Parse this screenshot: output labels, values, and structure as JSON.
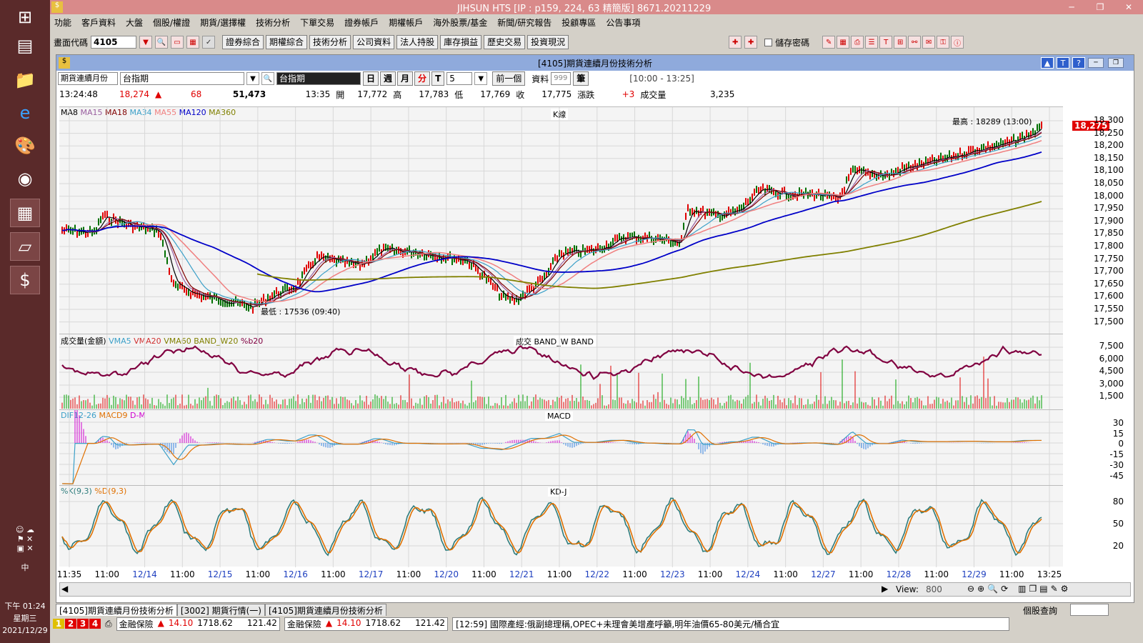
{
  "window": {
    "title": "JIHSUN HTS    [IP : p159, 224, 63 精簡版] 8671.20211229"
  },
  "menu": [
    "功能",
    "客戶資料",
    "大盤",
    "個股/權證",
    "期貨/選擇權",
    "技術分析",
    "下單交易",
    "證券帳戶",
    "期權帳戶",
    "海外股票/基金",
    "新聞/研究報告",
    "投顧專區",
    "公告事項"
  ],
  "toolbar": {
    "code_label": "畫面代碼",
    "code_value": "4105",
    "buttons": [
      "證券綜合",
      "期權綜合",
      "技術分析",
      "公司資料",
      "法人持股",
      "庫存損益",
      "歷史交易",
      "投資現況"
    ],
    "save_password": "儲存密碼"
  },
  "inner": {
    "title": "[4105]期貨連續月份技術分析",
    "symbol_type": "期貨連續月份",
    "symbol_name": "台指期",
    "symbol_selected": "台指期",
    "period_buttons": [
      "日",
      "週",
      "月",
      "分",
      "T"
    ],
    "period_value": "5",
    "prev_button": "前一個",
    "data_label": "資料",
    "data_count": "999",
    "data_unit": "筆",
    "time_range": "[10:00 - 13:25]"
  },
  "quote": {
    "time": "13:24:48",
    "price": "18,274",
    "change": "68",
    "volume_total": "51,473",
    "bar_time": "13:35",
    "open_label": "開",
    "open": "17,772",
    "high_label": "高",
    "high": "17,783",
    "low_label": "低",
    "low": "17,769",
    "close_label": "收",
    "close": "17,775",
    "chg_label": "漲跌",
    "chg": "+3",
    "vol_label": "成交量",
    "vol": "3,235"
  },
  "kline": {
    "title": "K線",
    "legend": [
      {
        "text": "MA8",
        "color": "#000000"
      },
      {
        "text": "MA15",
        "color": "#9a5fa0"
      },
      {
        "text": "MA18",
        "color": "#800000"
      },
      {
        "text": "MA34",
        "color": "#3ca0c8"
      },
      {
        "text": "MA55",
        "color": "#f08080"
      },
      {
        "text": "MA120",
        "color": "#0000c8"
      },
      {
        "text": "MA360",
        "color": "#808000"
      }
    ],
    "high_note": "最高 : 18289 (13:00)",
    "low_note": "最低 : 17536 (09:40)",
    "last_price": "18,275",
    "y_ticks": [
      "18,300",
      "18,250",
      "18,200",
      "18,150",
      "18,100",
      "18,050",
      "18,000",
      "17,950",
      "17,900",
      "17,850",
      "17,800",
      "17,750",
      "17,700",
      "17,650",
      "17,600",
      "17,550",
      "17,500"
    ]
  },
  "volume": {
    "title": "成交 BAND_W BAND",
    "legend": [
      {
        "text": "成交量(金額)",
        "color": "#000000"
      },
      {
        "text": "VMA5",
        "color": "#3ca0c8"
      },
      {
        "text": "VMA20",
        "color": "#d03030"
      },
      {
        "text": "VMA60",
        "color": "#808000"
      },
      {
        "text": "BAND_W20",
        "color": "#808000"
      },
      {
        "text": "%b20",
        "color": "#800040"
      }
    ],
    "y_ticks": [
      "7,500",
      "6,000",
      "4,500",
      "3,000",
      "1,500"
    ]
  },
  "macd": {
    "title": "MACD",
    "legend": [
      {
        "text": "DIF12-26",
        "color": "#3ca0c8"
      },
      {
        "text": "MACD9",
        "color": "#e07000"
      },
      {
        "text": "D-M",
        "color": "#d000d0"
      }
    ],
    "y_ticks": [
      "30",
      "15",
      "0",
      "-15",
      "-30",
      "-45"
    ]
  },
  "kd": {
    "title": "KD-J",
    "legend": [
      {
        "text": "%K(9,3)",
        "color": "#2e7d7d"
      },
      {
        "text": "%D(9,3)",
        "color": "#e07000"
      }
    ],
    "y_ticks": [
      "80",
      "50",
      "20"
    ]
  },
  "x_axis": [
    "11:35",
    "11:00",
    "12/14",
    "11:00",
    "12/15",
    "11:00",
    "12/16",
    "11:00",
    "12/17",
    "11:00",
    "12/20",
    "11:00",
    "12/21",
    "11:00",
    "12/22",
    "11:00",
    "12/23",
    "11:00",
    "12/24",
    "11:00",
    "12/27",
    "11:00",
    "12/28",
    "11:00",
    "12/29",
    "11:00",
    "13:25"
  ],
  "scrollbar": {
    "view_label": "View:",
    "view_value": "800"
  },
  "tabs": [
    "[4105]期貨連續月份技術分析",
    "[3002] 期貨行情(一)",
    "[4105]期貨連續月份技術分析"
  ],
  "right_search": "個股查詢",
  "status": {
    "pages": [
      "1",
      "2",
      "3",
      "4"
    ],
    "items": [
      {
        "name": "金融保險",
        "value": "14.10",
        "index": "1718.62",
        "change": "121.42"
      },
      {
        "name": "金融保險",
        "value": "14.10",
        "index": "1718.62",
        "change": "121.42"
      }
    ],
    "news": "[12:59] 國際產經:俄副總理稱,OPEC+未理會美增產呼籲,明年油價65-80美元/桶合宜"
  },
  "system": {
    "ime": "中",
    "clock_time": "下午 01:24",
    "clock_day": "星期三",
    "clock_date": "2021/12/29"
  }
}
